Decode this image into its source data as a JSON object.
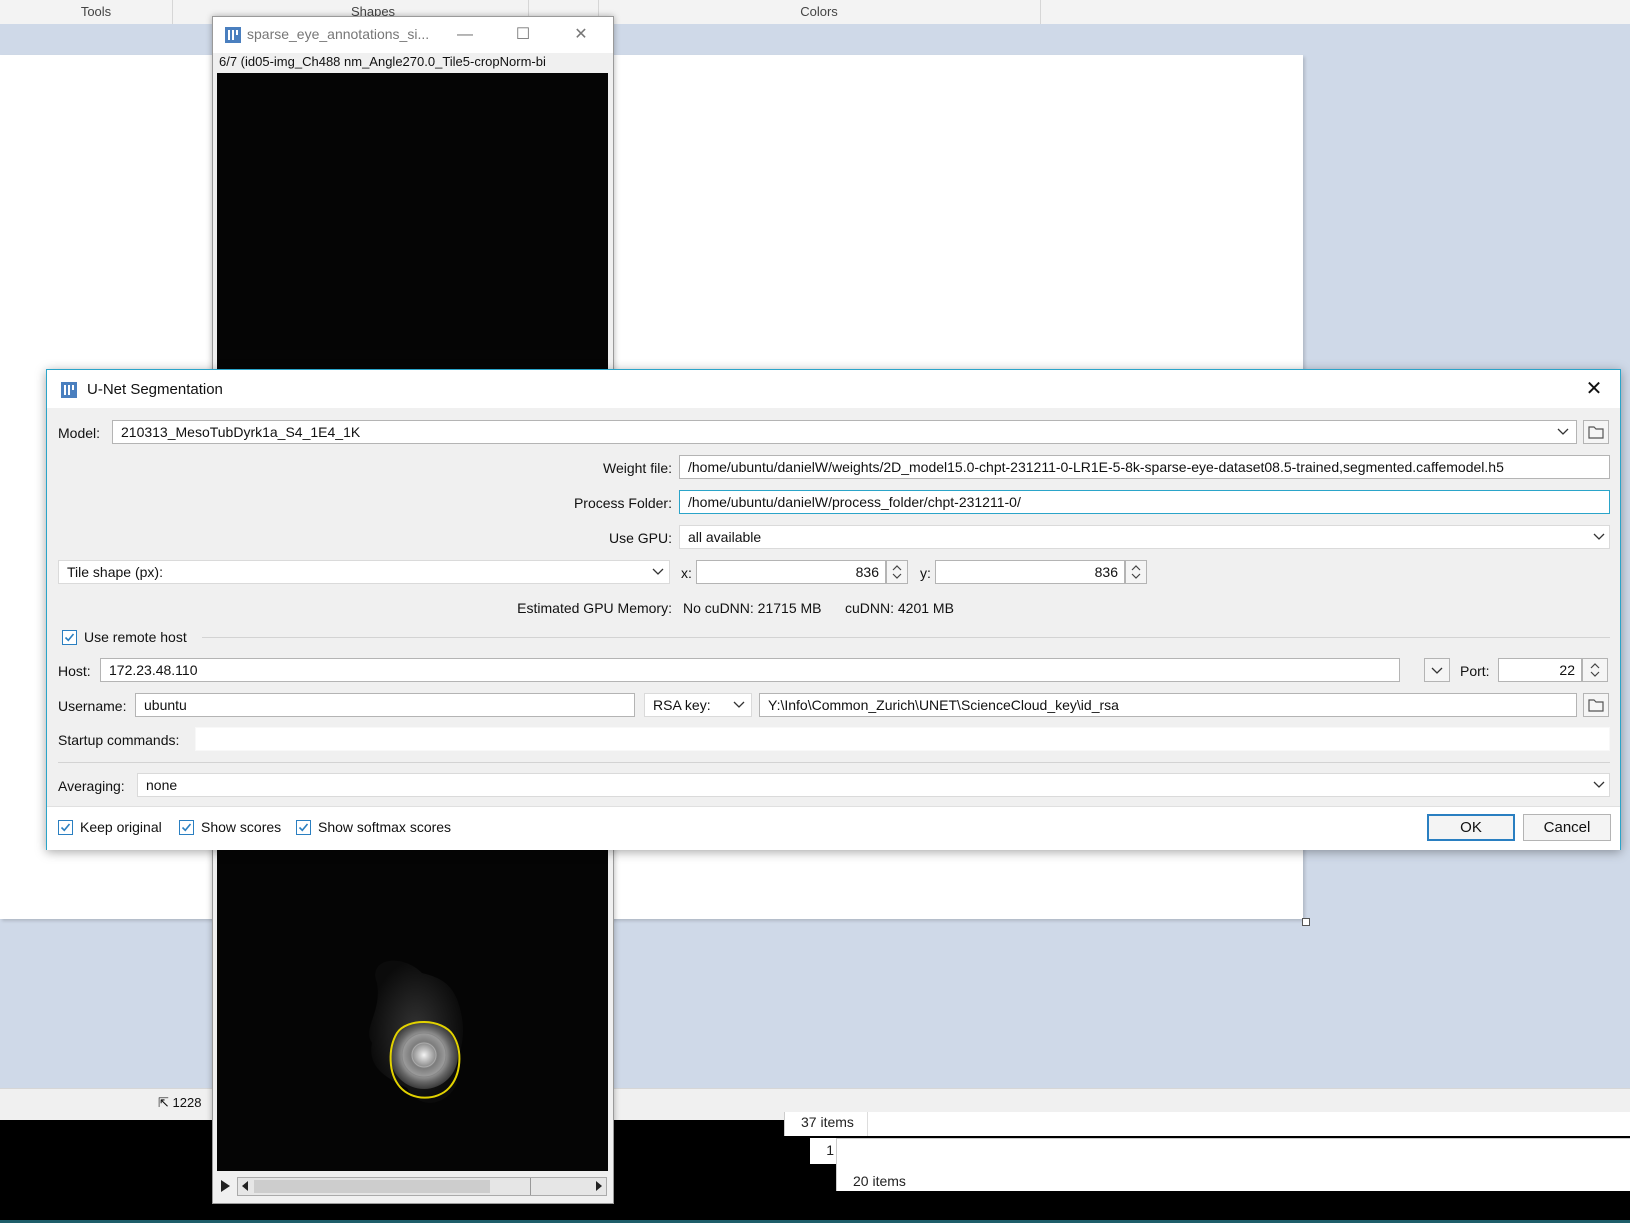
{
  "paint": {
    "ribbon": {
      "tools": "Tools",
      "shapes": "Shapes",
      "colors": "Colors"
    },
    "status_size": "1228"
  },
  "explorer": {
    "items_a": "37 items",
    "row_num": "1",
    "items_b": "20 items"
  },
  "image_window": {
    "title": "sparse_eye_annotations_si...",
    "subtitle": "6/7 (id05-img_Ch488 nm_Angle270.0_Tile5-cropNorm-bi",
    "controls": {
      "minimize": "—",
      "maximize": "☐",
      "close": "✕"
    }
  },
  "dialog": {
    "title": "U-Net Segmentation",
    "close": "✕",
    "model": {
      "label": "Model:",
      "value": "210313_MesoTubDyrk1a_S4_1E4_1K"
    },
    "weight_file": {
      "label": "Weight file:",
      "value": "/home/ubuntu/danielW/weights/2D_model15.0-chpt-231211-0-LR1E-5-8k-sparse-eye-dataset08.5-trained,segmented.caffemodel.h5"
    },
    "process_folder": {
      "label": "Process Folder:",
      "value": "/home/ubuntu/danielW/process_folder/chpt-231211-0/"
    },
    "use_gpu": {
      "label": "Use GPU:",
      "value": "all available"
    },
    "tile_shape": {
      "mode": "Tile shape (px):",
      "x_label": "x:",
      "x_value": "836",
      "y_label": "y:",
      "y_value": "836"
    },
    "gpu_memory": {
      "label": "Estimated GPU Memory:",
      "no_cudnn": "No cuDNN: 21715 MB",
      "cudnn": "cuDNN: 4201 MB"
    },
    "remote_host": {
      "label": "Use remote host",
      "checked": true
    },
    "host": {
      "label": "Host:",
      "value": "172.23.48.110",
      "port_label": "Port:",
      "port_value": "22"
    },
    "username": {
      "label": "Username:",
      "value": "ubuntu",
      "key_type": "RSA key:",
      "key_path": "Y:\\Info\\Common_Zurich\\UNET\\ScienceCloud_key\\id_rsa"
    },
    "startup": {
      "label": "Startup commands:",
      "value": ""
    },
    "averaging": {
      "label": "Averaging:",
      "value": "none"
    },
    "options": {
      "keep_original": "Keep original",
      "show_scores": "Show scores",
      "show_softmax": "Show softmax scores"
    },
    "ok": "OK",
    "cancel": "Cancel"
  },
  "colors": {
    "accent": "#2aa4c9",
    "checkbox": "#2a7fc1",
    "segmentation_outline": "#e2d200"
  }
}
